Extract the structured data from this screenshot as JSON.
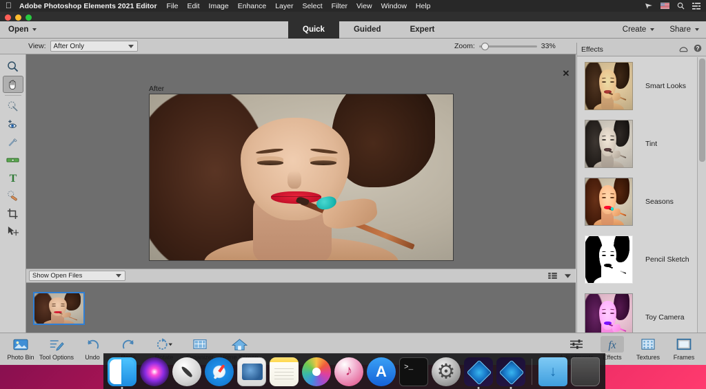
{
  "menubar": {
    "apple_icon": "apple-icon",
    "app_name": "Adobe Photoshop Elements 2021 Editor",
    "items": [
      "File",
      "Edit",
      "Image",
      "Enhance",
      "Layer",
      "Select",
      "Filter",
      "View",
      "Window",
      "Help"
    ],
    "right_icons": [
      "airplay-icon",
      "us-flag-icon",
      "search-icon",
      "control-center-icon"
    ]
  },
  "window": {
    "traffic_lights": [
      "close",
      "minimize",
      "maximize"
    ]
  },
  "toolbar": {
    "open_label": "Open",
    "modes": [
      {
        "label": "Quick",
        "active": true
      },
      {
        "label": "Guided",
        "active": false
      },
      {
        "label": "Expert",
        "active": false
      }
    ],
    "create_label": "Create",
    "share_label": "Share"
  },
  "options_bar": {
    "view_label": "View:",
    "view_value": "After Only",
    "zoom_label": "Zoom:",
    "zoom_value": "33%",
    "zoom_percent": 33
  },
  "tools": [
    {
      "name": "zoom-tool",
      "icon": "magnifier-icon",
      "selected": false
    },
    {
      "name": "hand-tool",
      "icon": "hand-icon",
      "selected": true
    },
    {
      "name": "quick-selection-tool",
      "icon": "quick-selection-icon",
      "selected": false
    },
    {
      "name": "red-eye-removal-tool",
      "icon": "eye-icon",
      "selected": false
    },
    {
      "name": "whiten-teeth-tool",
      "icon": "brush-icon",
      "selected": false
    },
    {
      "name": "straighten-tool",
      "icon": "level-icon",
      "selected": false
    },
    {
      "name": "type-tool",
      "icon": "text-t-icon",
      "selected": false
    },
    {
      "name": "spot-healing-brush-tool",
      "icon": "healing-brush-icon",
      "selected": false
    },
    {
      "name": "crop-tool",
      "icon": "crop-icon",
      "selected": false
    },
    {
      "name": "move-tool",
      "icon": "move-arrow-icon",
      "selected": false
    }
  ],
  "canvas": {
    "after_label": "After",
    "close_icon": "close-x-icon"
  },
  "photo_bin": {
    "filter_value": "Show Open Files",
    "view_icon": "list-view-icon",
    "chevron_icon": "chevron-down-icon",
    "thumbnails": [
      {
        "name": "open-photo-thumbnail",
        "selected": true
      }
    ]
  },
  "effects_panel": {
    "title": "Effects",
    "collapse_icon": "collapse-panel-icon",
    "help_icon": "help-icon",
    "items": [
      {
        "label": "Smart Looks",
        "style": "fx-smart"
      },
      {
        "label": "Tint",
        "style": "fx-tint"
      },
      {
        "label": "Seasons",
        "style": "fx-seasons"
      },
      {
        "label": "Pencil Sketch",
        "style": "fx-pencil"
      },
      {
        "label": "Toy Camera",
        "style": "fx-toy"
      }
    ]
  },
  "taskbar_left": [
    {
      "label": "Photo Bin",
      "icon": "photo-bin-icon",
      "active": false
    },
    {
      "label": "Tool Options",
      "icon": "tool-options-icon",
      "active": false
    },
    {
      "label": "Undo",
      "icon": "undo-arrow-icon",
      "active": false
    },
    {
      "label": "Redo",
      "icon": "redo-arrow-icon",
      "active": false
    },
    {
      "label": "Rotate",
      "icon": "rotate-icon",
      "active": false
    },
    {
      "label": "Organizer",
      "icon": "organizer-grid-icon",
      "active": false
    },
    {
      "label": "Home Screen",
      "icon": "home-icon",
      "active": false
    }
  ],
  "taskbar_right": [
    {
      "label": "Adjustments",
      "icon": "sliders-icon",
      "active": false
    },
    {
      "label": "Effects",
      "icon": "fx-icon",
      "active": true
    },
    {
      "label": "Textures",
      "icon": "textures-icon",
      "active": false
    },
    {
      "label": "Frames",
      "icon": "frame-icon",
      "active": false
    }
  ],
  "dock": [
    {
      "name": "finder",
      "cls": "d-finder",
      "running": true
    },
    {
      "name": "siri",
      "cls": "d-siri",
      "running": false
    },
    {
      "name": "launchpad",
      "cls": "d-launch",
      "running": false
    },
    {
      "name": "safari",
      "cls": "d-safari",
      "running": false
    },
    {
      "name": "mail",
      "cls": "d-mail",
      "running": false
    },
    {
      "name": "notes",
      "cls": "d-notes",
      "running": false
    },
    {
      "name": "photos",
      "cls": "d-photos",
      "running": false
    },
    {
      "name": "itunes",
      "cls": "d-itunes",
      "running": false
    },
    {
      "name": "app-store",
      "cls": "d-appstore",
      "running": false
    },
    {
      "name": "terminal",
      "cls": "d-terminal",
      "running": false
    },
    {
      "name": "system-preferences",
      "cls": "d-sysprefs",
      "running": false
    },
    {
      "name": "photoshop-elements-editor",
      "cls": "d-pse",
      "running": true
    },
    {
      "name": "photoshop-elements-organizer",
      "cls": "d-pse",
      "running": true
    },
    {
      "name": "downloads-folder",
      "cls": "d-downloads",
      "running": false
    },
    {
      "name": "trash",
      "cls": "d-trash",
      "running": false
    }
  ],
  "colors": {
    "accent_blue": "#2e7fd6",
    "mode_active_bg": "#2f2f2f",
    "chrome_gray": "#c9c9c9",
    "canvas_gray": "#6e6e6e"
  }
}
